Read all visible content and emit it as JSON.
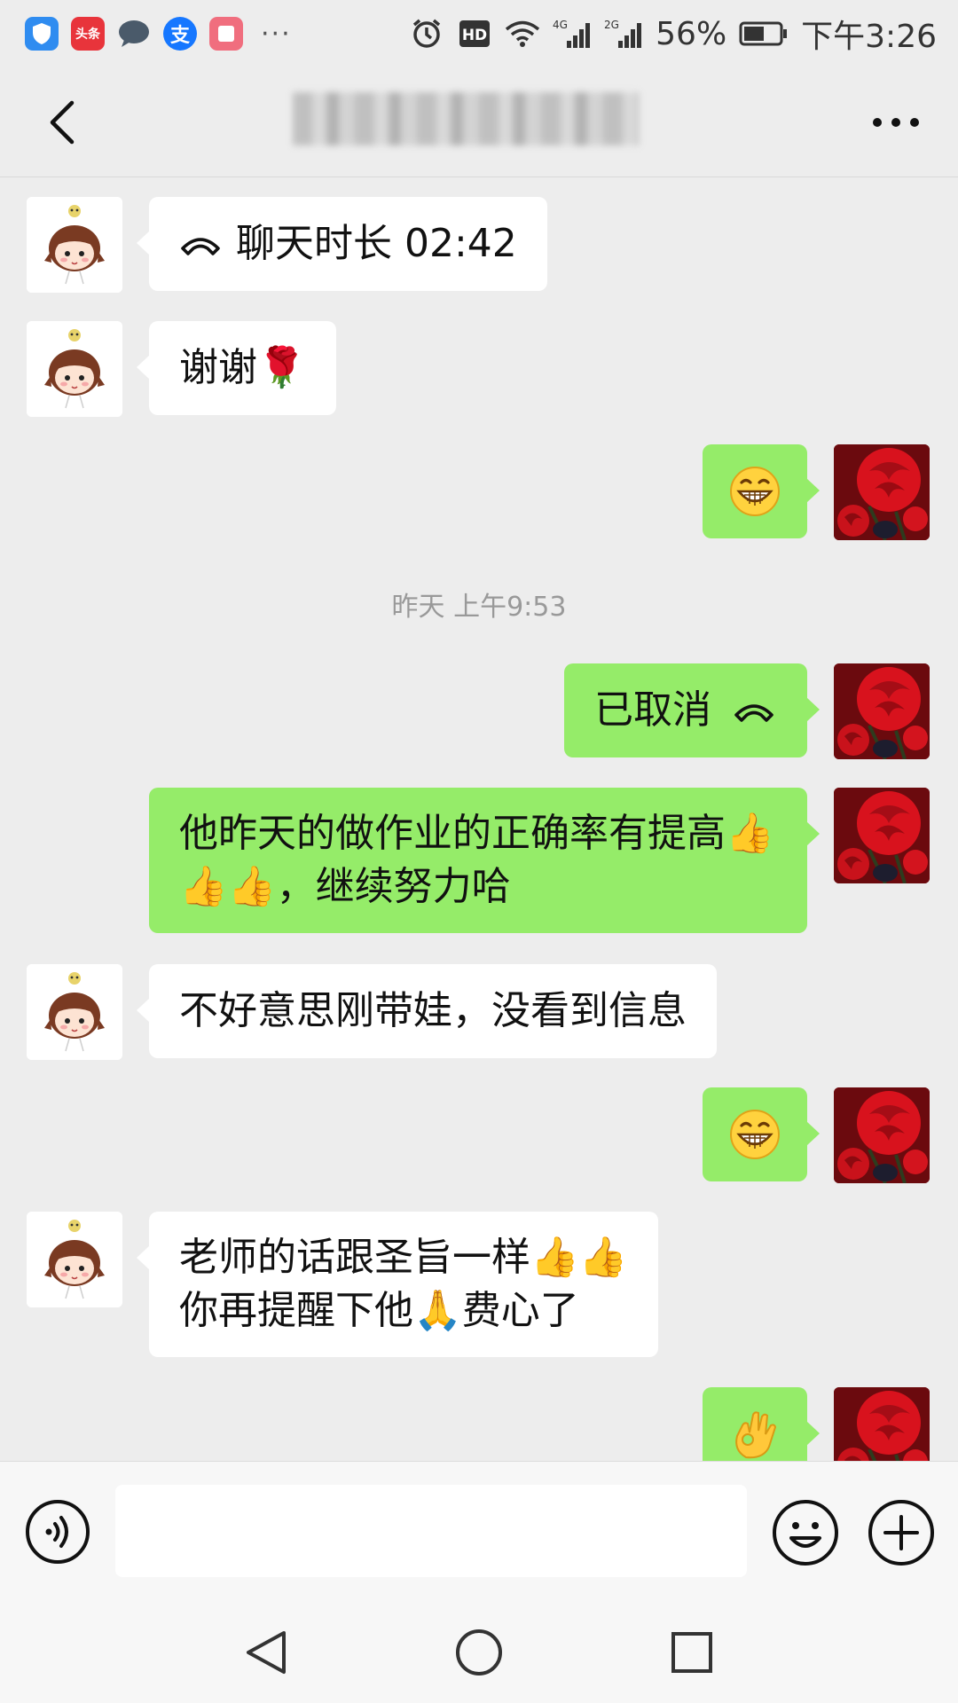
{
  "status_bar": {
    "app_icons": [
      {
        "name": "shield-app-icon",
        "color": "#2f8cf0",
        "glyph": "◆"
      },
      {
        "name": "toutiao-app-icon",
        "color": "#e8343b",
        "glyph": "头条"
      },
      {
        "name": "chat-app-icon",
        "color": "#4a5a6a",
        "glyph": "●"
      },
      {
        "name": "alipay-app-icon",
        "color": "#1677ff",
        "glyph": "支"
      },
      {
        "name": "reader-app-icon",
        "color": "#f06e7e",
        "glyph": "▯"
      }
    ],
    "more": "···",
    "network_4g": "4G",
    "network_2g": "2G",
    "battery": "56%",
    "time": "下午3:26"
  },
  "navbar": {
    "title_redacted": true
  },
  "messages": [
    {
      "side": "in",
      "kind": "call",
      "text": "聊天时长 02:42"
    },
    {
      "side": "in",
      "kind": "text",
      "text": "谢谢🌹"
    },
    {
      "side": "out",
      "kind": "emoji",
      "emoji": "grin"
    },
    {
      "side": "out",
      "kind": "call-out",
      "text": "已取消"
    },
    {
      "side": "out",
      "kind": "text",
      "line1": "他昨天的做作业的正确率有提高👍",
      "line2": "👍👍，继续努力哈"
    },
    {
      "side": "in",
      "kind": "text",
      "text": "不好意思刚带娃，没看到信息"
    },
    {
      "side": "out",
      "kind": "emoji",
      "emoji": "grin"
    },
    {
      "side": "in",
      "kind": "text",
      "line1": "老师的话跟圣旨一样👍👍",
      "line2": "你再提醒下他🙏费心了"
    },
    {
      "side": "out",
      "kind": "emoji",
      "emoji": "ok-hand"
    }
  ],
  "timestamp": "昨天 上午9:53",
  "colors": {
    "background": "#ededed",
    "outgoing_bubble": "#95ec69",
    "incoming_bubble": "#ffffff"
  }
}
